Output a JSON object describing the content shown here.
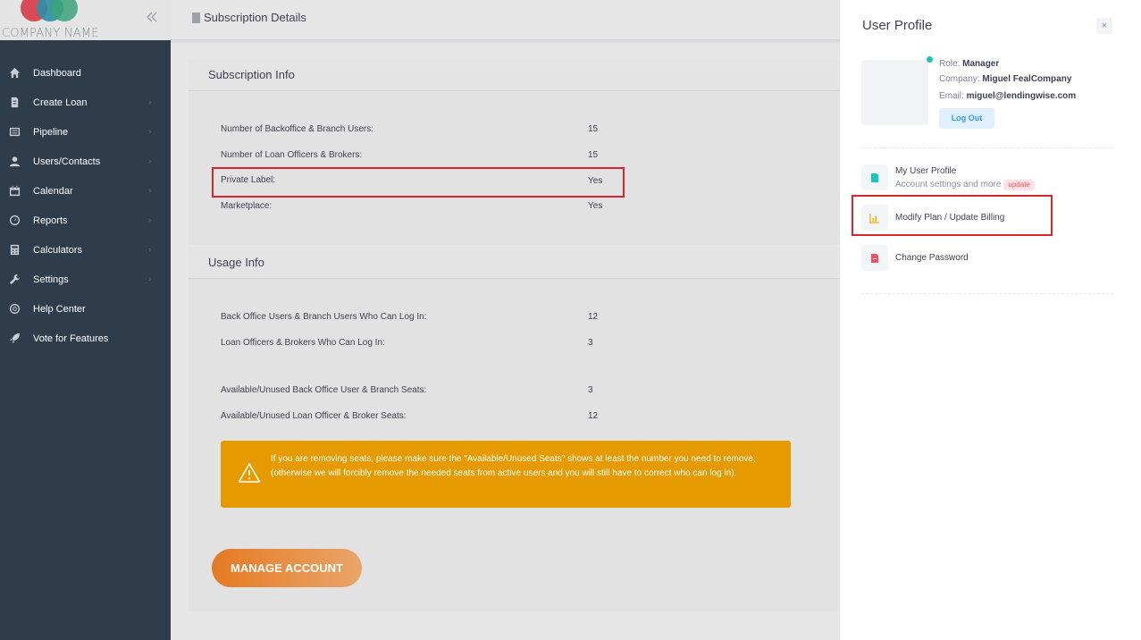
{
  "brand": {
    "company_name": "COMPANY NAME"
  },
  "sidebar": {
    "items": [
      {
        "label": "Dashboard",
        "icon": "home-icon",
        "has_arrow": false
      },
      {
        "label": "Create Loan",
        "icon": "document-icon",
        "has_arrow": true
      },
      {
        "label": "Pipeline",
        "icon": "list-icon",
        "has_arrow": true
      },
      {
        "label": "Users/Contacts",
        "icon": "user-icon",
        "has_arrow": true
      },
      {
        "label": "Calendar",
        "icon": "calendar-icon",
        "has_arrow": true
      },
      {
        "label": "Reports",
        "icon": "gauge-icon",
        "has_arrow": true
      },
      {
        "label": "Calculators",
        "icon": "calculator-icon",
        "has_arrow": true
      },
      {
        "label": "Settings",
        "icon": "wrench-icon",
        "has_arrow": true
      },
      {
        "label": "Help Center",
        "icon": "lifebuoy-icon",
        "has_arrow": false
      },
      {
        "label": "Vote for Features",
        "icon": "rocket-icon",
        "has_arrow": false
      }
    ]
  },
  "header": {
    "title": "Subscription Details"
  },
  "subscription_info": {
    "title": "Subscription Info",
    "rows": [
      {
        "label": "Number of Backoffice & Branch Users:",
        "value": "15"
      },
      {
        "label": "Number of Loan Officers & Brokers:",
        "value": "15"
      },
      {
        "label": "Private Label:",
        "value": "Yes"
      },
      {
        "label": "Marketplace:",
        "value": "Yes"
      }
    ]
  },
  "usage_info": {
    "title": "Usage Info",
    "rows": [
      {
        "label": "Back Office Users & Branch Users Who Can Log In:",
        "value": "12"
      },
      {
        "label": "Loan Officers & Brokers Who Can Log In:",
        "value": "3"
      },
      {
        "label": "Available/Unused Back Office User & Branch Seats:",
        "value": "3"
      },
      {
        "label": "Available/Unused Loan Officer & Broker Seats:",
        "value": "12"
      }
    ]
  },
  "alert": {
    "text": "If you are removing seats, please make sure the \"Available/Unused Seats\" shows at least the number you need to remove, (otherwise we will forcibly remove the needed seats from active users and you will still have to correct who can log in)."
  },
  "manage_button": "MANAGE ACCOUNT",
  "profile_panel": {
    "title": "User Profile",
    "close": "×",
    "role_label": "Role:",
    "role": "Manager",
    "company_label": "Company:",
    "company": "Miguel FealCompany",
    "email_label": "Email:",
    "email": "miguel@lendingwise.com",
    "logout": "Log Out",
    "menu": [
      {
        "label": "My User Profile",
        "sub": "Account settings and more",
        "badge": "update",
        "icon": "profile-card-icon"
      },
      {
        "label": "Modify Plan / Update Billing",
        "icon": "chart-icon"
      },
      {
        "label": "Change Password",
        "icon": "file-lock-icon"
      }
    ]
  },
  "colors": {
    "sidebar_bg": "#2f3c4b",
    "alert_bg": "#e59a00",
    "highlight": "#d9252b",
    "accent_orange": "#e57a24",
    "online": "#1bc5bd"
  }
}
